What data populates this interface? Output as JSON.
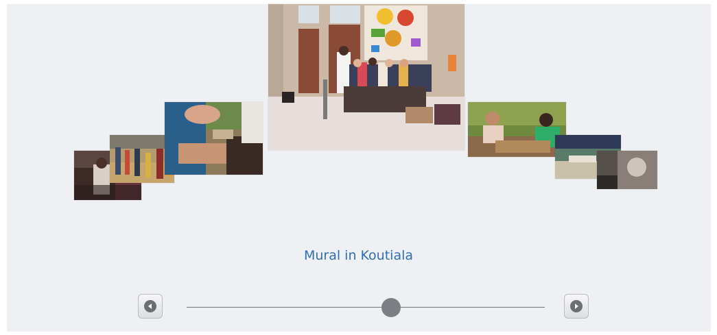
{
  "carousel": {
    "caption": "Mural in Koutiala",
    "slider_fraction": 0.57,
    "photos": [
      "photo-village-man",
      "photo-market-street",
      "photo-hands-crafting",
      "photo-mural-group",
      "photo-weaving-women",
      "photo-river-landscape",
      "photo-dark-portrait"
    ]
  },
  "controls": {
    "prev_icon": "arrow-left-icon",
    "next_icon": "arrow-right-icon"
  },
  "colors": {
    "background": "#eef0f3",
    "caption": "#2f6db3",
    "track": "#6e7176",
    "thumb": "#7b7e83"
  }
}
